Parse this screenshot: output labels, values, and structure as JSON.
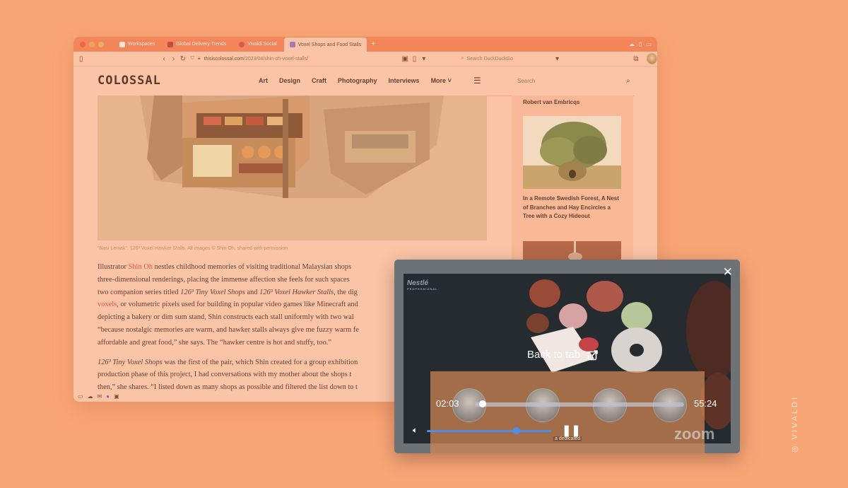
{
  "browser": {
    "tabs": [
      {
        "label": "Workspaces",
        "favicon": "home-icon",
        "active": false
      },
      {
        "label": "Global Delivery Trends",
        "favicon": "youtube-icon",
        "active": false
      },
      {
        "label": "Vivaldi Social",
        "favicon": "vivaldi-icon",
        "active": false
      },
      {
        "label": "Voxel Shops and Food Stalls",
        "favicon": "page-icon",
        "active": true
      }
    ],
    "url_domain": "thisiscolossal.com",
    "url_path": "/2023/04/shin-oh-voxel-stalls/",
    "search_placeholder": "Search DuckDuckGo"
  },
  "site": {
    "logo": "COLOSSAL",
    "nav": [
      "Art",
      "Design",
      "Craft",
      "Photography",
      "Interviews",
      "More ˅"
    ],
    "search_placeholder": "Search"
  },
  "article": {
    "caption": "\"Nasi Lemak\", 126³ Voxel Hawker Stalls. All images © Shin Oh, shared with permission",
    "p1_lines": [
      [
        "Illustrator ",
        {
          "link": "Shin Oh"
        },
        " nestles childhood memories of visiting traditional Malaysian shops"
      ],
      [
        "three-dimensional renderings, placing the immense affection she feels for such spaces"
      ],
      [
        "two companion series titled ",
        {
          "em": "126³ Tiny Voxel Shops"
        },
        " and ",
        {
          "em": "126³ Voxel Hawker Stalls"
        },
        ", the dig"
      ],
      [
        {
          "link": "voxels"
        },
        ", or volumetric pixels used for building in popular video games like Minecraft and"
      ],
      [
        "depicting a bakery or dim sum stand, Shin constructs each stall uniformly with two wal"
      ],
      [
        "“because nostalgic memories are warm, and hawker stalls always give me fuzzy warm fe"
      ],
      [
        "affordable and great food,” she says. The “hawker centre is hot and stuffy, too.”"
      ]
    ],
    "p2_lines": [
      [
        {
          "em": "126³ Tiny Voxel Shops"
        },
        " was the first of the pair, which Shin created for a group exhibition"
      ],
      [
        "production phase of this project, I had conversations with my mother about the shops t"
      ],
      [
        "then,” she shares. “I listed down as many shops as possible and filtered the list down to t"
      ]
    ]
  },
  "sidebar": {
    "top_label": "Robert van Embricqs",
    "feature_title": "In a Remote Swedish Forest, A Nest of Branches and Hay Encircles a Tree with a Cozy Hideout"
  },
  "pip": {
    "brand": "Nestlé",
    "brand_sub": "PROFESSIONAL",
    "back_label": "Back to tab",
    "time_current": "02:03",
    "time_total": "55:24",
    "progress_fraction": 0.037,
    "volume_fraction": 0.72,
    "zoom_watermark": "zoom",
    "caption_snippet": "a dedicated"
  },
  "brand_vertical": "VIVALDI"
}
